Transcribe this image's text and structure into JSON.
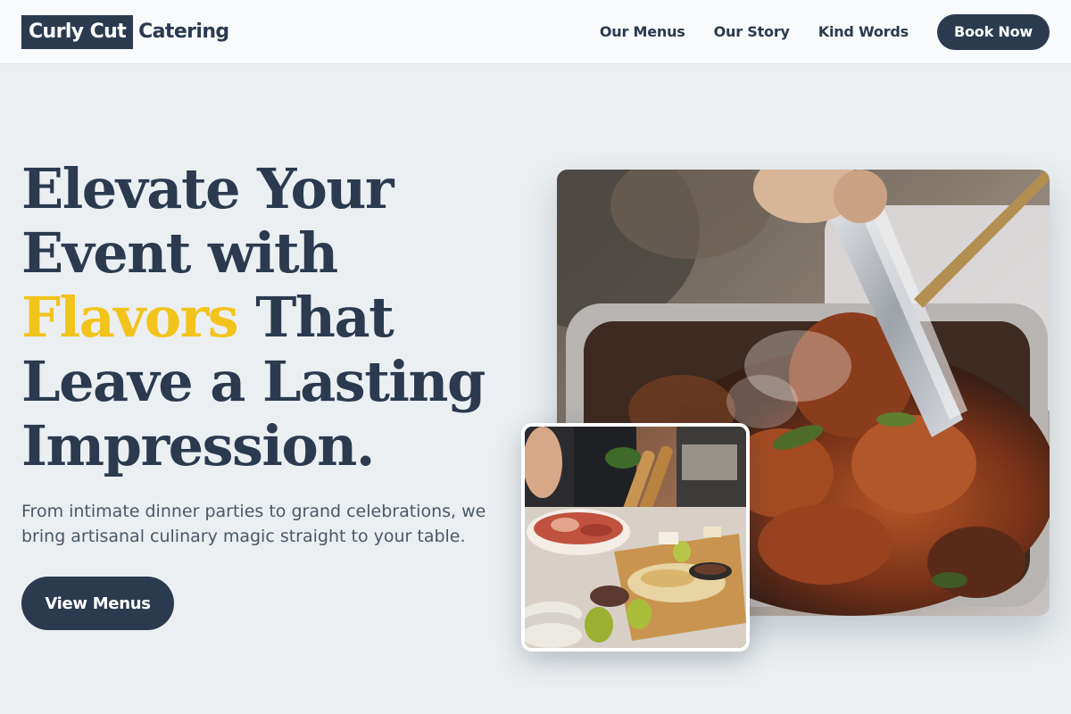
{
  "brand": {
    "logo_box": "Curly Cut",
    "logo_text": "Catering"
  },
  "nav": {
    "items": [
      "Our Menus",
      "Our Story",
      "Kind Words"
    ],
    "cta": "Book Now"
  },
  "hero": {
    "line1": "Elevate Your",
    "line2": "Event with",
    "accent_word": "Flavors",
    "line3_rest": " That",
    "line4": "Leave a Lasting",
    "line5": "Impression.",
    "subtext": "From intimate dinner parties to grand celebrations, we bring artisanal culinary magic straight to your table.",
    "cta": "View Menus"
  },
  "colors": {
    "navy": "#2b3a4f",
    "accent": "#f2c31a",
    "background": "#ebeff1"
  }
}
